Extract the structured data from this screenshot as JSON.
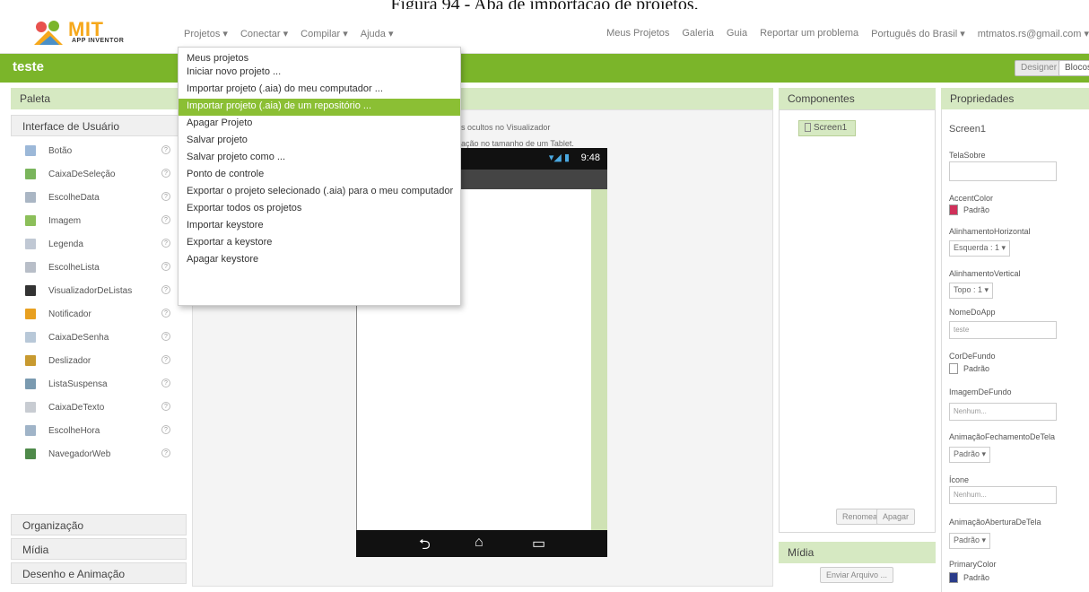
{
  "caption": "Figura 94 - Aba de importação de projetos.",
  "logo": {
    "title": "MIT",
    "subtitle": "APP INVENTOR"
  },
  "topmenu": [
    "Projetos ▾",
    "Conectar ▾",
    "Compilar ▾",
    "Ajuda ▾"
  ],
  "rightmenu": [
    "Meus Projetos",
    "Galeria",
    "Guia",
    "Reportar um problema",
    "Português do Brasil ▾",
    "mtmatos.rs@gmail.com ▾"
  ],
  "project": {
    "name": "teste",
    "designer_label": "Designer",
    "blocks_label": "Blocos"
  },
  "palette": {
    "title": "Paleta",
    "category": "Interface de Usuário",
    "items": [
      {
        "label": "Botão",
        "icon": "button-icon",
        "color": "#9cb8d8"
      },
      {
        "label": "CaixaDeSeleção",
        "icon": "checkbox-icon",
        "color": "#7ab55c"
      },
      {
        "label": "EscolheData",
        "icon": "calendar-icon",
        "color": "#aab6c4"
      },
      {
        "label": "Imagem",
        "icon": "image-icon",
        "color": "#8cbf5a"
      },
      {
        "label": "Legenda",
        "icon": "label-icon",
        "color": "#c0c8d4"
      },
      {
        "label": "EscolheLista",
        "icon": "listpicker-icon",
        "color": "#b8bec8"
      },
      {
        "label": "VisualizadorDeListas",
        "icon": "listview-icon",
        "color": "#333333"
      },
      {
        "label": "Notificador",
        "icon": "notifier-icon",
        "color": "#e8a020"
      },
      {
        "label": "CaixaDeSenha",
        "icon": "password-icon",
        "color": "#b8c8d8"
      },
      {
        "label": "Deslizador",
        "icon": "slider-icon",
        "color": "#c89a30"
      },
      {
        "label": "ListaSuspensa",
        "icon": "spinner-icon",
        "color": "#7a9ab0"
      },
      {
        "label": "CaixaDeTexto",
        "icon": "textbox-icon",
        "color": "#c8ccd2"
      },
      {
        "label": "EscolheHora",
        "icon": "clock-icon",
        "color": "#a0b4c8"
      },
      {
        "label": "NavegadorWeb",
        "icon": "web-icon",
        "color": "#4f8a4a"
      }
    ],
    "help_glyph": "?",
    "categories_below": [
      "Organização",
      "Mídia",
      "Desenho e Animação"
    ]
  },
  "viewer": {
    "note1": "s ocultos no Visualizador",
    "note2": "ação no tamanho de um Tablet.",
    "status_icons": "▾◢ ▮",
    "time": "9:48",
    "nav": [
      "⮌",
      "⌂",
      "▭"
    ]
  },
  "components": {
    "title": "Componentes",
    "screen": "Screen1",
    "rename_label": "Renomear",
    "delete_label": "Apagar",
    "media_title": "Mídia",
    "upload_label": "Enviar Arquivo ..."
  },
  "properties": {
    "title": "Propriedades",
    "screen": "Screen1",
    "tela_sobre": "TelaSobre",
    "accent_label": "AccentColor",
    "accent_value": "Padrão",
    "accent_color": "#d0305a",
    "align_h_label": "AlinhamentoHorizontal",
    "align_h_value": "Esquerda : 1 ▾",
    "align_v_label": "AlinhamentoVertical",
    "align_v_value": "Topo : 1 ▾",
    "appname_label": "NomeDoApp",
    "appname_value": "teste",
    "bg_label": "CorDeFundo",
    "bg_value": "Padrão",
    "bgimage_label": "ImagemDeFundo",
    "bgimage_value": "Nenhum...",
    "close_anim_label": "AnimaçãoFechamentoDeTela",
    "close_anim_value": "Padrão ▾",
    "icon_label": "Ícone",
    "icon_value": "Nenhum...",
    "open_anim_label": "AnimaçãoAberturaDeTela",
    "open_anim_value": "Padrão ▾",
    "primary_label": "PrimaryColor",
    "primary_value": "Padrão",
    "primary_color": "#2a3c8a"
  },
  "dropdown": {
    "items": [
      "Meus projetos",
      "Iniciar novo projeto ...",
      "Importar projeto (.aia) do meu computador ...",
      "Importar projeto (.aia) de um repositório ...",
      "Apagar Projeto",
      "Salvar projeto",
      "Salvar projeto como ...",
      "Ponto de controle",
      "Exportar o projeto selecionado (.aia) para o meu computador",
      "Exportar todos os projetos",
      "Importar keystore",
      "Exportar a keystore",
      "Apagar keystore"
    ],
    "highlight_index": 3
  }
}
